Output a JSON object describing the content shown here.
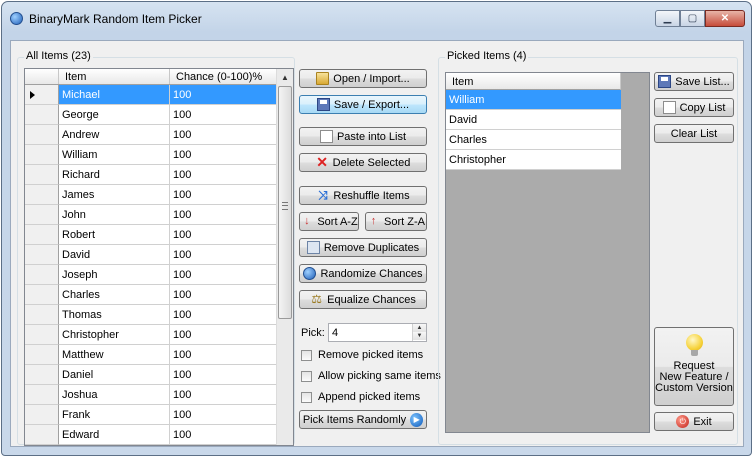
{
  "window": {
    "title": "BinaryMark Random Item Picker",
    "controls": {
      "minimize": "▁",
      "maximize": "▢",
      "close": "✕"
    }
  },
  "all_items": {
    "label": "All Items (23)",
    "columns": [
      "Item",
      "Chance (0-100)%"
    ],
    "selected_index": 0,
    "rows": [
      {
        "item": "Michael",
        "chance": "100"
      },
      {
        "item": "George",
        "chance": "100"
      },
      {
        "item": "Andrew",
        "chance": "100"
      },
      {
        "item": "William",
        "chance": "100"
      },
      {
        "item": "Richard",
        "chance": "100"
      },
      {
        "item": "James",
        "chance": "100"
      },
      {
        "item": "John",
        "chance": "100"
      },
      {
        "item": "Robert",
        "chance": "100"
      },
      {
        "item": "David",
        "chance": "100"
      },
      {
        "item": "Joseph",
        "chance": "100"
      },
      {
        "item": "Charles",
        "chance": "100"
      },
      {
        "item": "Thomas",
        "chance": "100"
      },
      {
        "item": "Christopher",
        "chance": "100"
      },
      {
        "item": "Matthew",
        "chance": "100"
      },
      {
        "item": "Daniel",
        "chance": "100"
      },
      {
        "item": "Joshua",
        "chance": "100"
      },
      {
        "item": "Frank",
        "chance": "100"
      },
      {
        "item": "Edward",
        "chance": "100"
      }
    ]
  },
  "actions": {
    "open_import": "Open / Import...",
    "save_export": "Save / Export...",
    "paste_into_list": "Paste into List",
    "delete_selected": "Delete Selected",
    "reshuffle_items": "Reshuffle Items",
    "sort_az": "Sort A-Z",
    "sort_za": "Sort Z-A",
    "remove_duplicates": "Remove Duplicates",
    "randomize_chances": "Randomize Chances",
    "equalize_chances": "Equalize Chances",
    "pick_label": "Pick:",
    "pick_value": "4",
    "remove_picked": "Remove picked items",
    "allow_same": "Allow picking same items",
    "append_picked": "Append picked items",
    "pick_items_randomly": "Pick Items Randomly"
  },
  "picked_items": {
    "label": "Picked Items (4)",
    "column": "Item",
    "selected_index": 0,
    "rows": [
      "William",
      "David",
      "Charles",
      "Christopher"
    ]
  },
  "right_buttons": {
    "save_list": "Save List...",
    "copy_list": "Copy List",
    "clear_list": "Clear List",
    "feature_line1": "Request",
    "feature_line2": "New Feature /",
    "feature_line3": "Custom Version",
    "exit": "Exit"
  }
}
